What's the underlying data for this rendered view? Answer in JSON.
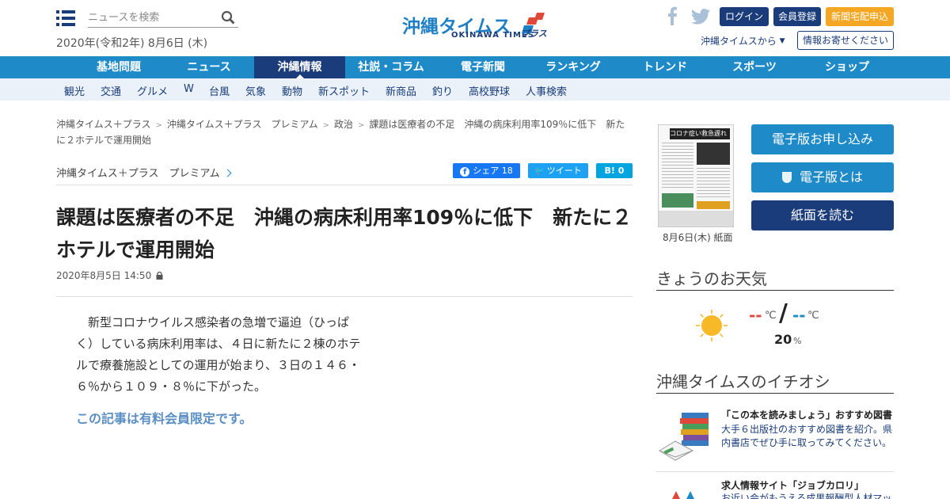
{
  "header": {
    "search_placeholder": "ニュースを検索",
    "date": "2020年(令和2年) 8月6日 (木)",
    "logo_text": "沖縄タイムス",
    "logo_en": "OKINAWA TIMES",
    "logo_plus": "プラス",
    "login": "ログイン",
    "register": "会員登録",
    "delivery": "新聞宅配申込",
    "from_times": "沖縄タイムスから",
    "tip": "情報お寄せください"
  },
  "mainnav": [
    "基地問題",
    "ニュース",
    "沖縄情報",
    "社説・コラム",
    "電子新聞",
    "ランキング",
    "トレンド",
    "スポーツ",
    "ショップ"
  ],
  "subnav": [
    "観光",
    "交通",
    "グルメ",
    "W",
    "台風",
    "気象",
    "動物",
    "新スポット",
    "新商品",
    "釣り",
    "高校野球",
    "人事検索"
  ],
  "breadcrumb": {
    "items": [
      "沖縄タイムス＋プラス",
      "沖縄タイムス＋プラス　プレミアム",
      "政治"
    ],
    "current": "課題は医療者の不足　沖縄の病床利用率109％に低下　新たに２ホテルで運用開始"
  },
  "article": {
    "category": "沖縄タイムス＋プラス　プレミアム",
    "share_fb": "シェア 18",
    "share_tw": "ツイート",
    "share_hb": "B! 0",
    "title": "課題は医療者の不足　沖縄の病床利用率109％に低下　新たに２ホテルで運用開始",
    "datetime": "2020年8月5日 14:50",
    "body": "　新型コロナウイルス感染者の急増で逼迫（ひっぱく）している病床利用率は、４日に新たに２棟のホテルで療養施設としての運用が始まり、３日の１４６・６％から１０９・８％に下がった。",
    "paywall": "この記事は有料会員限定です。"
  },
  "sidebar": {
    "paper_caption": "8月6日(木) 紙面",
    "paper_headline": "コロナ症い救急遅れ",
    "btn_digital": "電子版お申し込み",
    "btn_about": "電子版とは",
    "btn_read": "紙面を読む",
    "weather_title": "きょうのお天気",
    "temp_high": "--",
    "temp_low": "--",
    "temp_unit": "℃",
    "slash": "/",
    "precip": "20",
    "precip_unit": "%",
    "pick_title": "沖縄タイムスのイチオシ",
    "pick1_title": "「この本を読みましょう」おすすめ図書",
    "pick1_desc": "大手６出版社のおすすめ図書を紹介。県内書店でぜひ手に取ってみてください。",
    "pick2_title": "求人情報サイト「ジョブカロリ」",
    "pick2_desc": "お近い会がもうえる成果報酬型人材マッ"
  },
  "colors": {
    "brand_blue": "#1f8ac8",
    "navy": "#1a3c7a",
    "orange": "#f5a623"
  }
}
